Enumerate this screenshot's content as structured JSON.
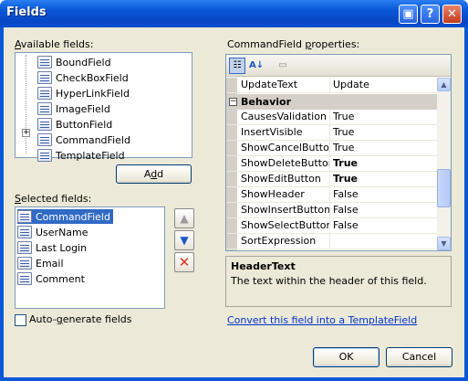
{
  "window": {
    "title": "Fields"
  },
  "title_buttons": {
    "restore": "▣",
    "help": "?",
    "close": "✕"
  },
  "available": {
    "label_pre": "",
    "label_accel": "A",
    "label_post": "vailable fields:",
    "items": [
      {
        "label": "BoundField",
        "icon": "bound-field-icon"
      },
      {
        "label": "CheckBoxField",
        "icon": "checkbox-field-icon"
      },
      {
        "label": "HyperLinkField",
        "icon": "hyperlink-field-icon"
      },
      {
        "label": "ImageField",
        "icon": "image-field-icon"
      },
      {
        "label": "ButtonField",
        "icon": "button-field-icon"
      },
      {
        "label": "CommandField",
        "icon": "command-field-icon"
      },
      {
        "label": "TemplateField",
        "icon": "template-field-icon"
      }
    ]
  },
  "add_button": {
    "label_pre": "A",
    "label_accel": "d",
    "label_post": "d"
  },
  "selected": {
    "label_pre": "",
    "label_accel": "S",
    "label_post": "elected fields:",
    "items": [
      {
        "label": "CommandField",
        "icon": "command-field-icon",
        "selected": true
      },
      {
        "label": "UserName",
        "icon": "bound-field-icon"
      },
      {
        "label": "Last Login",
        "icon": "bound-field-icon"
      },
      {
        "label": "Email",
        "icon": "bound-field-icon"
      },
      {
        "label": "Comment",
        "icon": "bound-field-icon"
      }
    ]
  },
  "move_buttons": {
    "up": "up-arrow-icon",
    "down": "down-arrow-icon",
    "delete": "delete-x-icon"
  },
  "properties": {
    "label_pre": "CommandField ",
    "label_accel": "p",
    "label_post": "roperties:",
    "category": "Behavior",
    "category_toggle": "−",
    "top_row": {
      "name": "UpdateText",
      "value": "Update"
    },
    "rows": [
      {
        "name": "CausesValidation",
        "value": "True",
        "bold": false
      },
      {
        "name": "InsertVisible",
        "value": "True",
        "bold": false
      },
      {
        "name": "ShowCancelButton",
        "value": "True",
        "bold": false
      },
      {
        "name": "ShowDeleteButton",
        "value": "True",
        "bold": true
      },
      {
        "name": "ShowEditButton",
        "value": "True",
        "bold": true
      },
      {
        "name": "ShowHeader",
        "value": "False",
        "bold": false
      },
      {
        "name": "ShowInsertButton",
        "value": "False",
        "bold": false
      },
      {
        "name": "ShowSelectButton",
        "value": "False",
        "bold": false
      },
      {
        "name": "SortExpression",
        "value": "",
        "bold": false
      }
    ],
    "toolbar": {
      "categorized": "categorized-icon",
      "alphabetical": "alphabetical-sort-icon",
      "pages": "property-pages-icon"
    }
  },
  "description": {
    "title": "HeaderText",
    "text": "The text within the header of this field."
  },
  "auto_generate": {
    "label_pre": "Auto-",
    "label_accel": "g",
    "label_post": "enerate fields",
    "checked": false
  },
  "convert_link": "Convert this field into a TemplateField",
  "ok_button": "OK",
  "cancel_button": "Cancel",
  "colors": {
    "selection": "#316ac5",
    "dialog_bg": "#ece9d8",
    "title_blue": "#0a58d8",
    "link": "#0033cc"
  }
}
